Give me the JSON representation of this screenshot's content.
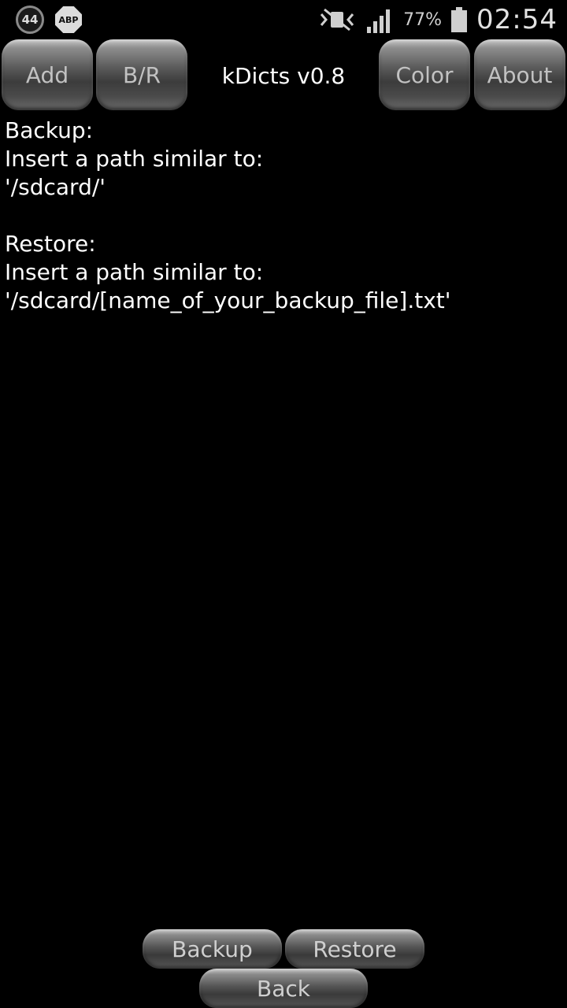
{
  "status_bar": {
    "notification_count": "44",
    "abp_label": "ABP",
    "battery_percent": "77%",
    "clock": "02:54",
    "icons": [
      "notification-count-badge",
      "adblock-plus-icon",
      "silent-mode-icon",
      "signal-icon",
      "battery-icon"
    ]
  },
  "top_bar": {
    "add_label": "Add",
    "br_label": "B/R",
    "title": "kDicts v0.8",
    "color_label": "Color",
    "about_label": "About"
  },
  "content": {
    "backup_heading": "Backup:",
    "backup_instruction": "Insert a path similar to:",
    "backup_example": "'/sdcard/'",
    "restore_heading": "Restore:",
    "restore_instruction": "Insert a path similar to:",
    "restore_example": "'/sdcard/[name_of_your_backup_file].txt'"
  },
  "bottom_bar": {
    "backup_label": "Backup",
    "restore_label": "Restore",
    "back_label": "Back"
  },
  "colors": {
    "background": "#000000",
    "text": "#ffffff",
    "button_text": "#c2c2c2"
  }
}
